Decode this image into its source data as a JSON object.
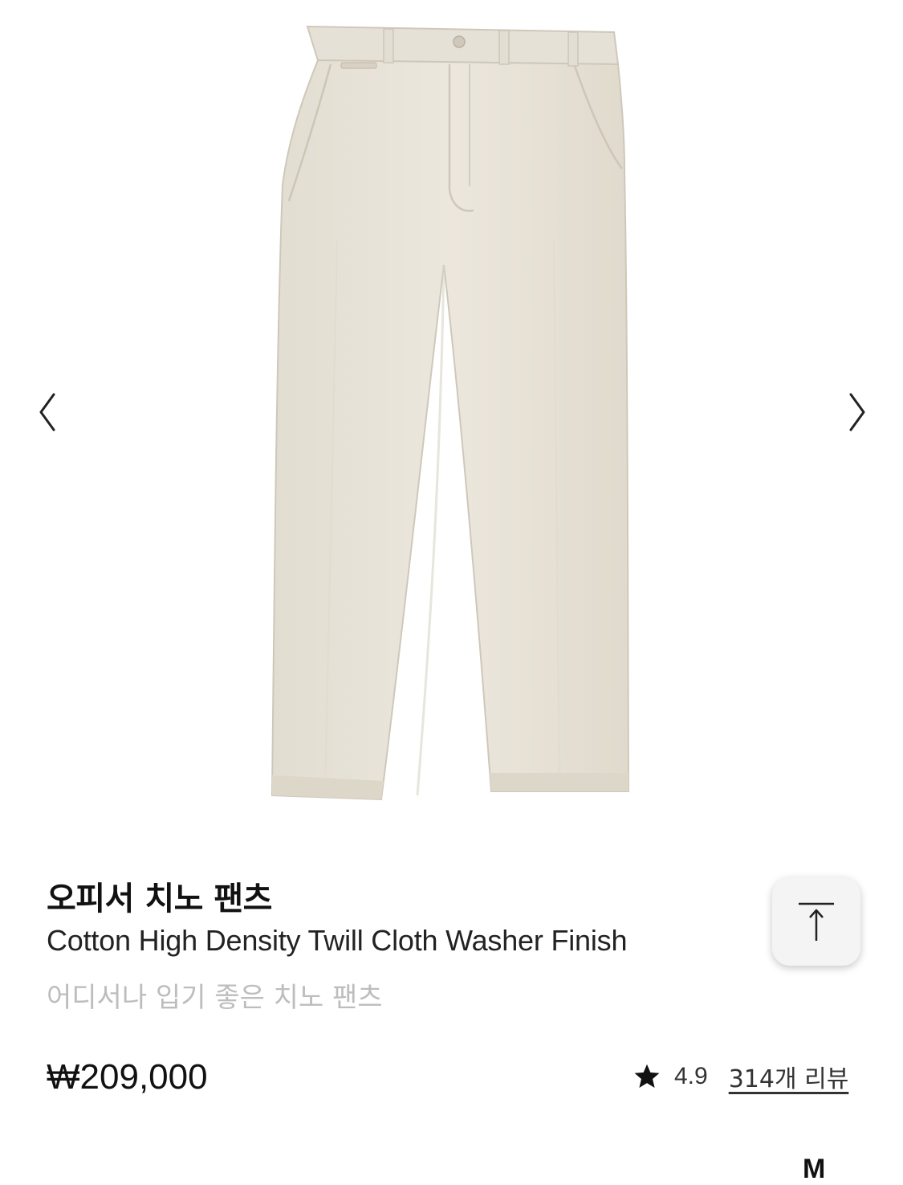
{
  "product": {
    "name_ko": "오피서 치노 팬츠",
    "name_en": "Cotton High Density Twill Cloth Washer Finish",
    "tagline": "어디서나 입기 좋은 치노 팬츠",
    "price": "₩209,000",
    "rating": "4.9",
    "review_link": "314개 리뷰",
    "image_subject": "beige chino pants"
  },
  "gallery": {
    "prev_icon": "chevron-left-icon",
    "next_icon": "chevron-right-icon"
  },
  "controls": {
    "scroll_top_icon": "arrow-up-to-top-icon",
    "star_icon": "star-icon"
  },
  "peek_text": "M",
  "colors": {
    "fabric": "#e8e3d8",
    "fabric_shadow": "#d5cfc2",
    "subtitle_gray": "#bdbdbd",
    "button_bg": "#f4f4f4"
  }
}
